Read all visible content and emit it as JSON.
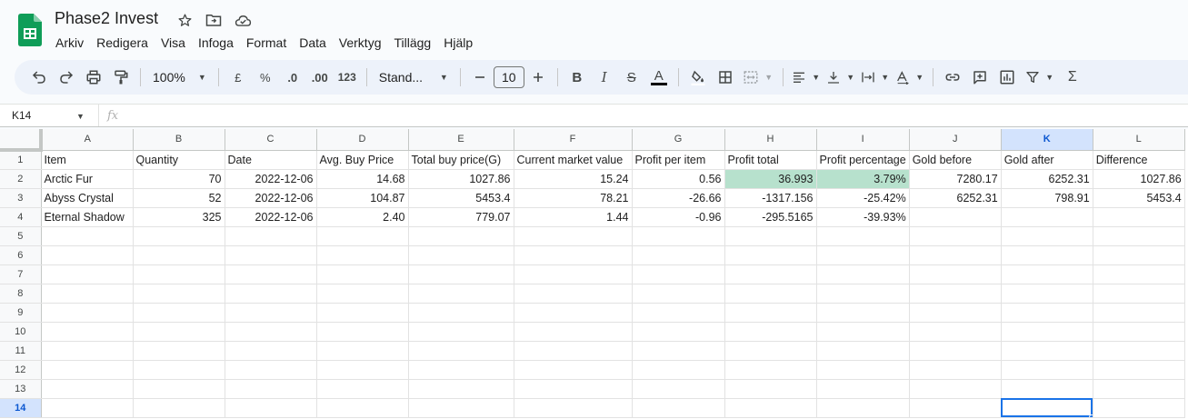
{
  "app": {
    "title": "Phase2 Invest",
    "menus": [
      "Arkiv",
      "Redigera",
      "Visa",
      "Infoga",
      "Format",
      "Data",
      "Verktyg",
      "Tillägg",
      "Hjälp"
    ]
  },
  "toolbar": {
    "zoom": "100%",
    "currency": "£",
    "percent": "%",
    "decrease_decimals": ".0",
    "increase_decimals": ".00",
    "more_formats": "123",
    "font": "Stand...",
    "font_size": "10",
    "icons": [
      "undo-icon",
      "redo-icon",
      "print-icon",
      "paint-format-icon",
      "minus-icon",
      "plus-icon",
      "bold-icon",
      "italic-icon",
      "strikethrough-icon",
      "text-color-icon",
      "fill-color-icon",
      "borders-icon",
      "merge-icon",
      "align-icon",
      "valign-icon",
      "text-wrap-icon",
      "text-rotate-icon",
      "link-icon",
      "comment-icon",
      "chart-icon",
      "filter-icon",
      "functions-icon"
    ]
  },
  "formula_bar": {
    "cell_ref": "K14",
    "fx_label": "fx"
  },
  "colors": {
    "positive": "#38761d",
    "negative": "#cc0000",
    "positive_fill": "#b7e1cd",
    "selection": "#1a73e8"
  },
  "sheet": {
    "columns": [
      "A",
      "B",
      "C",
      "D",
      "E",
      "F",
      "G",
      "H",
      "I",
      "J",
      "K",
      "L"
    ],
    "active_column": "K",
    "active_row": 14,
    "selected_cell": "K14",
    "row_numbers": [
      "1",
      "2",
      "3",
      "4",
      "5",
      "6",
      "7",
      "8",
      "9",
      "10",
      "11",
      "12",
      "13",
      "14"
    ],
    "headers": [
      "Item",
      "Quantity",
      "Date",
      "Avg. Buy Price",
      "Total buy price(G)",
      "Current market value",
      "Profit per item",
      "Profit total",
      "Profit percentage",
      "Gold before",
      "Gold after",
      "Difference"
    ],
    "rows": [
      [
        "Arctic Fur",
        "70",
        "2022-12-06",
        "14.68",
        "1027.86",
        "15.24",
        "0.56",
        "36.993",
        "3.79%",
        "7280.17",
        "6252.31",
        "1027.86"
      ],
      [
        "Abyss Crystal",
        "52",
        "2022-12-06",
        "104.87",
        "5453.4",
        "78.21",
        "-26.66",
        "-1317.156",
        "-25.42%",
        "6252.31",
        "798.91",
        "5453.4"
      ],
      [
        "Eternal Shadow",
        "325",
        "2022-12-06",
        "2.40",
        "779.07",
        "1.44",
        "-0.96",
        "-295.5165",
        "-39.93%",
        "",
        "",
        ""
      ]
    ]
  }
}
